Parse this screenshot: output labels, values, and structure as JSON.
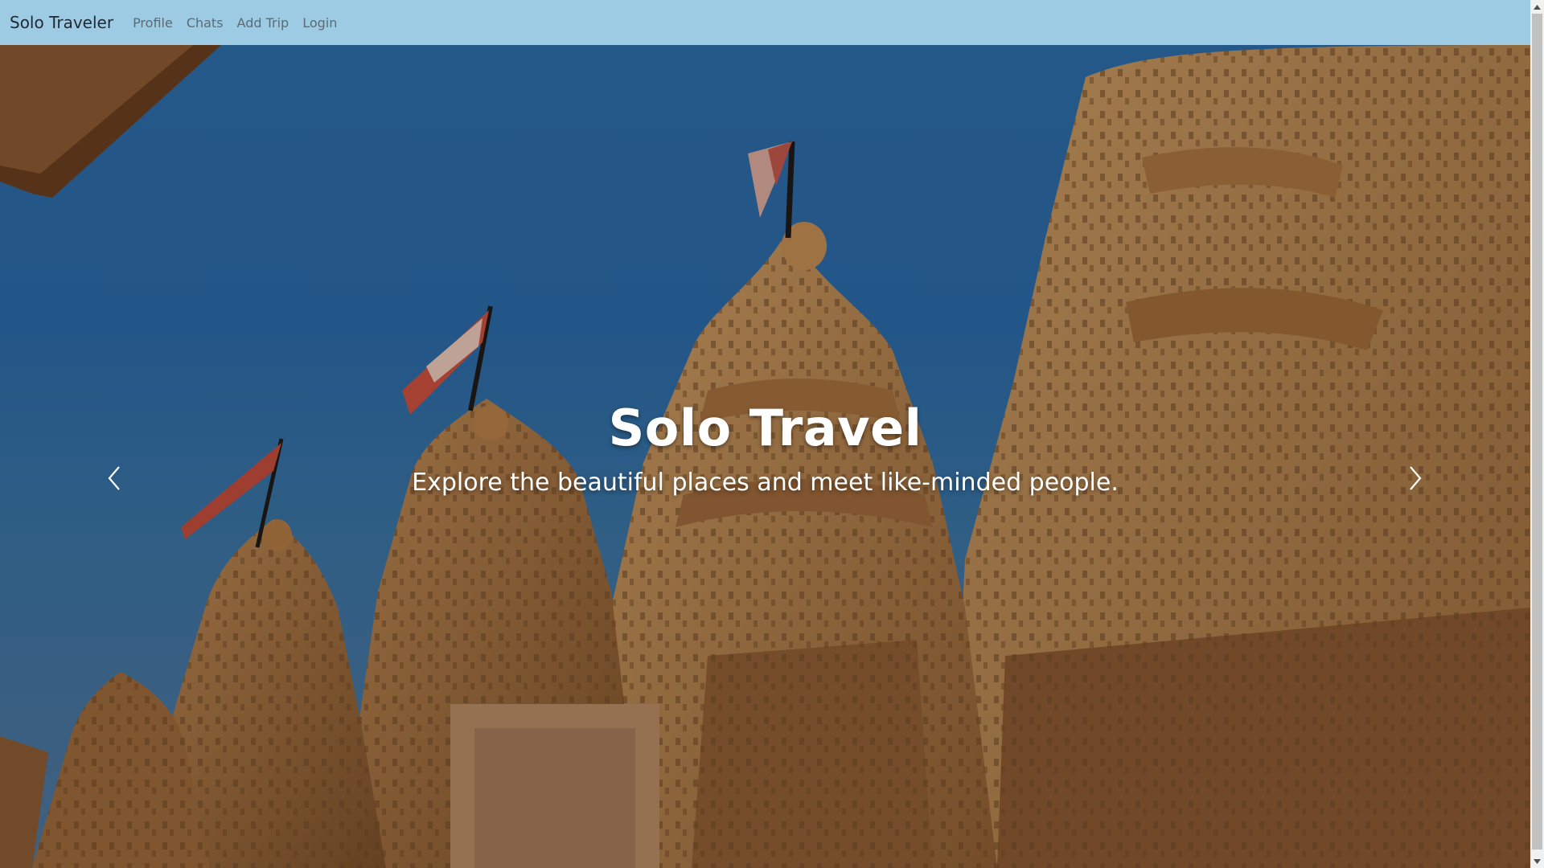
{
  "navbar": {
    "brand": "Solo Traveler",
    "links": [
      "Profile",
      "Chats",
      "Add Trip",
      "Login"
    ]
  },
  "hero": {
    "title": "Solo Travel",
    "subtitle": "Explore the beautiful places and meet like-minded people.",
    "prev_icon": "chevron-left-icon",
    "next_icon": "chevron-right-icon"
  },
  "colors": {
    "navbar_bg": "#9ccbe3",
    "sky": "#2d6ca8",
    "stone": "#c9955c"
  }
}
